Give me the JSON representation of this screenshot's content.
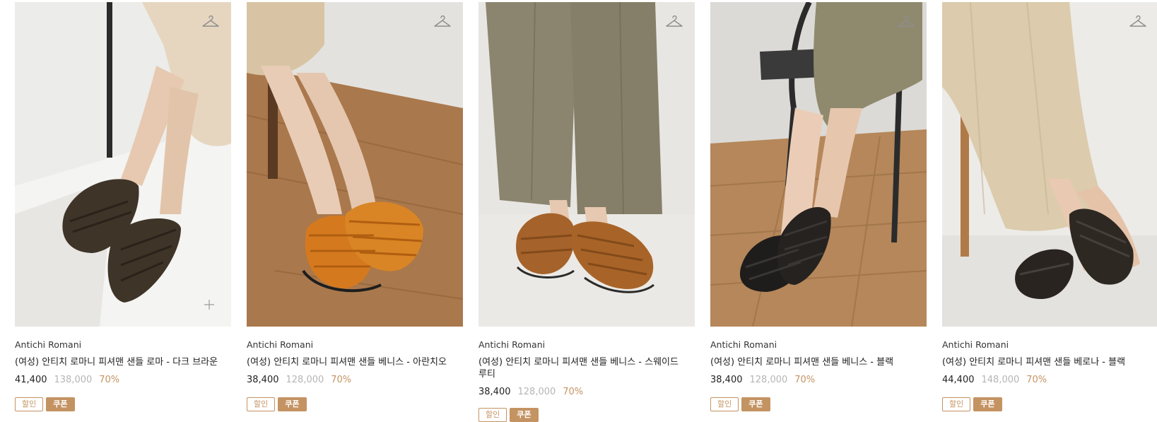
{
  "products": [
    {
      "brand": "Antichi Romani",
      "name": "(여성) 안티치 로마니 피셔맨 샌들 로마 - 다크 브라운",
      "price": "41,400",
      "original_price": "138,000",
      "discount": "70%",
      "badges": [
        "할인",
        "쿠폰"
      ],
      "photo_colors": {
        "bg": "#ececea",
        "floor": "#f3f3f1",
        "sandal": "#3e3428",
        "pants": "#e6d6c0",
        "skin": "#e6c9b0"
      },
      "icons": [
        "hanger-icon",
        "plus-icon"
      ]
    },
    {
      "brand": "Antichi Romani",
      "name": "(여성) 안티치 로마니 피셔맨 샌들 베니스 - 아란치오",
      "price": "38,400",
      "original_price": "128,000",
      "discount": "70%",
      "badges": [
        "할인",
        "쿠폰"
      ],
      "photo_colors": {
        "bg": "#e4e2de",
        "floor": "#a9784c",
        "sandal": "#d5791f",
        "pants": "#d8c4a4",
        "skin": "#e9ccb6"
      },
      "icons": [
        "hanger-icon"
      ]
    },
    {
      "brand": "Antichi Romani",
      "name": "(여성) 안티치 로마니 피셔맨 샌들 베니스 - 스웨이드 루티",
      "price": "38,400",
      "original_price": "128,000",
      "discount": "70%",
      "badges": [
        "할인",
        "쿠폰"
      ],
      "photo_colors": {
        "bg": "#e8e6e2",
        "floor": "#ebe9e5",
        "sandal": "#a5622a",
        "pants": "#8b8570",
        "skin": "#e7c8b0"
      },
      "icons": [
        "hanger-icon"
      ]
    },
    {
      "brand": "Antichi Romani",
      "name": "(여성) 안티치 로마니 피셔맨 샌들 베니스 - 블랙",
      "price": "38,400",
      "original_price": "128,000",
      "discount": "70%",
      "badges": [
        "할인",
        "쿠폰"
      ],
      "photo_colors": {
        "bg": "#dcdad6",
        "floor": "#b5875a",
        "sandal": "#1f1d1c",
        "pants": "#8f8a6e",
        "skin": "#ebcdb7"
      },
      "icons": [
        "hanger-icon"
      ]
    },
    {
      "brand": "Antichi Romani",
      "name": "(여성) 안티치 로마니 피셔맨 샌들 베로나 - 블랙",
      "price": "44,400",
      "original_price": "148,000",
      "discount": "70%",
      "badges": [
        "할인",
        "쿠폰"
      ],
      "photo_colors": {
        "bg": "#ecebe8",
        "floor": "#e4e2de",
        "sandal": "#2a2420",
        "pants": "#dccbac",
        "skin": "#e9c9b1"
      },
      "icons": [
        "hanger-icon"
      ]
    }
  ],
  "accent_color": "#c49362"
}
